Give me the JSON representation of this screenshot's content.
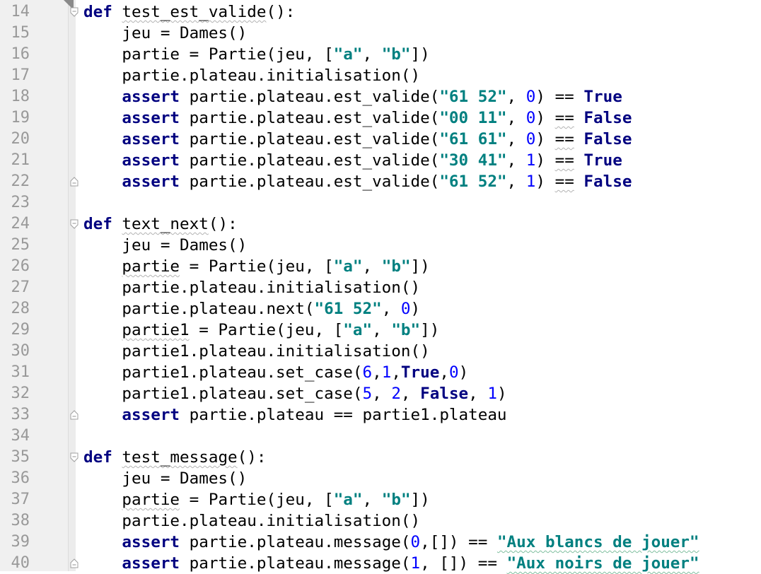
{
  "gutter": {
    "line_numbers": [
      "14",
      "15",
      "16",
      "17",
      "18",
      "19",
      "20",
      "21",
      "22",
      "23",
      "24",
      "25",
      "26",
      "27",
      "28",
      "29",
      "30",
      "31",
      "32",
      "33",
      "34",
      "35",
      "36",
      "37",
      "38",
      "39",
      "40"
    ]
  },
  "code": {
    "lines": [
      [
        {
          "t": "def",
          "s": "kw"
        },
        {
          "t": " ",
          "s": "plain"
        },
        {
          "t": "test_est_valide",
          "s": "squig"
        },
        {
          "t": "():",
          "s": "plain"
        }
      ],
      [
        {
          "t": "    jeu = Dames()",
          "s": "plain"
        }
      ],
      [
        {
          "t": "    partie = Partie(jeu, [",
          "s": "plain"
        },
        {
          "t": "\"a\"",
          "s": "str"
        },
        {
          "t": ", ",
          "s": "plain"
        },
        {
          "t": "\"b\"",
          "s": "str"
        },
        {
          "t": "])",
          "s": "plain"
        }
      ],
      [
        {
          "t": "    partie.plateau.initialisation()",
          "s": "plain"
        }
      ],
      [
        {
          "t": "    ",
          "s": "plain"
        },
        {
          "t": "assert",
          "s": "kw"
        },
        {
          "t": " partie.plateau.est_valide(",
          "s": "plain"
        },
        {
          "t": "\"61 52\"",
          "s": "str"
        },
        {
          "t": ", ",
          "s": "plain"
        },
        {
          "t": "0",
          "s": "num"
        },
        {
          "t": ") == ",
          "s": "plain"
        },
        {
          "t": "True",
          "s": "kw"
        }
      ],
      [
        {
          "t": "    ",
          "s": "plain"
        },
        {
          "t": "assert",
          "s": "kw"
        },
        {
          "t": " partie.plateau.est_valide(",
          "s": "plain"
        },
        {
          "t": "\"00 11\"",
          "s": "str"
        },
        {
          "t": ", ",
          "s": "plain"
        },
        {
          "t": "0",
          "s": "num"
        },
        {
          "t": ") ",
          "s": "plain"
        },
        {
          "t": "==",
          "s": "squig"
        },
        {
          "t": " ",
          "s": "plain"
        },
        {
          "t": "False",
          "s": "kw"
        }
      ],
      [
        {
          "t": "    ",
          "s": "plain"
        },
        {
          "t": "assert",
          "s": "kw"
        },
        {
          "t": " partie.plateau.est_valide(",
          "s": "plain"
        },
        {
          "t": "\"61 61\"",
          "s": "str"
        },
        {
          "t": ", ",
          "s": "plain"
        },
        {
          "t": "0",
          "s": "num"
        },
        {
          "t": ") ",
          "s": "plain"
        },
        {
          "t": "==",
          "s": "squig"
        },
        {
          "t": " ",
          "s": "plain"
        },
        {
          "t": "False",
          "s": "kw"
        }
      ],
      [
        {
          "t": "    ",
          "s": "plain"
        },
        {
          "t": "assert",
          "s": "kw"
        },
        {
          "t": " partie.plateau.est_valide(",
          "s": "plain"
        },
        {
          "t": "\"30 41\"",
          "s": "str"
        },
        {
          "t": ", ",
          "s": "plain"
        },
        {
          "t": "1",
          "s": "num"
        },
        {
          "t": ") ",
          "s": "plain"
        },
        {
          "t": "==",
          "s": "squig"
        },
        {
          "t": " ",
          "s": "plain"
        },
        {
          "t": "True",
          "s": "kw"
        }
      ],
      [
        {
          "t": "    ",
          "s": "plain"
        },
        {
          "t": "assert",
          "s": "kw"
        },
        {
          "t": " partie.plateau.est_valide(",
          "s": "plain"
        },
        {
          "t": "\"61 52\"",
          "s": "str"
        },
        {
          "t": ", ",
          "s": "plain"
        },
        {
          "t": "1",
          "s": "num"
        },
        {
          "t": ") ",
          "s": "plain"
        },
        {
          "t": "==",
          "s": "squig"
        },
        {
          "t": " ",
          "s": "plain"
        },
        {
          "t": "False",
          "s": "kw"
        }
      ],
      [],
      [
        {
          "t": "def",
          "s": "kw"
        },
        {
          "t": " ",
          "s": "plain"
        },
        {
          "t": "text_next",
          "s": "squig"
        },
        {
          "t": "():",
          "s": "plain"
        }
      ],
      [
        {
          "t": "    jeu = Dames()",
          "s": "plain"
        }
      ],
      [
        {
          "t": "    ",
          "s": "plain"
        },
        {
          "t": "partie",
          "s": "squig"
        },
        {
          "t": " = Partie(jeu, [",
          "s": "plain"
        },
        {
          "t": "\"a\"",
          "s": "str"
        },
        {
          "t": ", ",
          "s": "plain"
        },
        {
          "t": "\"b\"",
          "s": "str"
        },
        {
          "t": "])",
          "s": "plain"
        }
      ],
      [
        {
          "t": "    partie.plateau.initialisation()",
          "s": "plain"
        }
      ],
      [
        {
          "t": "    partie.plateau.next(",
          "s": "plain"
        },
        {
          "t": "\"61 52\"",
          "s": "str"
        },
        {
          "t": ", ",
          "s": "plain"
        },
        {
          "t": "0",
          "s": "num"
        },
        {
          "t": ")",
          "s": "plain"
        }
      ],
      [
        {
          "t": "    ",
          "s": "plain"
        },
        {
          "t": "partie1",
          "s": "squig"
        },
        {
          "t": " = Partie(jeu, [",
          "s": "plain"
        },
        {
          "t": "\"a\"",
          "s": "str"
        },
        {
          "t": ", ",
          "s": "plain"
        },
        {
          "t": "\"b\"",
          "s": "str"
        },
        {
          "t": "])",
          "s": "plain"
        }
      ],
      [
        {
          "t": "    partie1.plateau.initialisation()",
          "s": "plain"
        }
      ],
      [
        {
          "t": "    partie1.plateau.set_case(",
          "s": "plain"
        },
        {
          "t": "6",
          "s": "num"
        },
        {
          "t": ",",
          "s": "plain"
        },
        {
          "t": "1",
          "s": "num"
        },
        {
          "t": ",",
          "s": "plain"
        },
        {
          "t": "True",
          "s": "kw"
        },
        {
          "t": ",",
          "s": "plain"
        },
        {
          "t": "0",
          "s": "num"
        },
        {
          "t": ")",
          "s": "plain"
        }
      ],
      [
        {
          "t": "    partie1.plateau.set_case(",
          "s": "plain"
        },
        {
          "t": "5",
          "s": "num"
        },
        {
          "t": ", ",
          "s": "plain"
        },
        {
          "t": "2",
          "s": "num"
        },
        {
          "t": ", ",
          "s": "plain"
        },
        {
          "t": "False",
          "s": "kw"
        },
        {
          "t": ", ",
          "s": "plain"
        },
        {
          "t": "1",
          "s": "num"
        },
        {
          "t": ")",
          "s": "plain"
        }
      ],
      [
        {
          "t": "    ",
          "s": "plain"
        },
        {
          "t": "assert",
          "s": "kw"
        },
        {
          "t": " partie.plateau == partie1.plateau",
          "s": "plain"
        }
      ],
      [],
      [
        {
          "t": "def",
          "s": "kw"
        },
        {
          "t": " ",
          "s": "plain"
        },
        {
          "t": "test_message",
          "s": "squig"
        },
        {
          "t": "():",
          "s": "plain"
        }
      ],
      [
        {
          "t": "    jeu = Dames()",
          "s": "plain"
        }
      ],
      [
        {
          "t": "    ",
          "s": "plain"
        },
        {
          "t": "partie",
          "s": "squig"
        },
        {
          "t": " = Partie(jeu, [",
          "s": "plain"
        },
        {
          "t": "\"a\"",
          "s": "str"
        },
        {
          "t": ", ",
          "s": "plain"
        },
        {
          "t": "\"b\"",
          "s": "str"
        },
        {
          "t": "])",
          "s": "plain"
        }
      ],
      [
        {
          "t": "    partie.plateau.initialisation()",
          "s": "plain"
        }
      ],
      [
        {
          "t": "    ",
          "s": "plain"
        },
        {
          "t": "assert",
          "s": "kw"
        },
        {
          "t": " partie.plateau.message(",
          "s": "plain"
        },
        {
          "t": "0",
          "s": "num"
        },
        {
          "t": ",[]) == ",
          "s": "plain"
        },
        {
          "t": "\"Aux blancs de jouer\"",
          "s": "strsquig"
        }
      ],
      [
        {
          "t": "    ",
          "s": "plain"
        },
        {
          "t": "assert",
          "s": "kw"
        },
        {
          "t": " partie.plateau.message(",
          "s": "plain"
        },
        {
          "t": "1",
          "s": "num"
        },
        {
          "t": ", []) == ",
          "s": "plain"
        },
        {
          "t": "\"Aux noirs de jouer\"",
          "s": "strsquig"
        }
      ]
    ]
  },
  "folds": [
    {
      "line": 0,
      "kind": "open"
    },
    {
      "line": 8,
      "kind": "close"
    },
    {
      "line": 10,
      "kind": "open"
    },
    {
      "line": 19,
      "kind": "close"
    },
    {
      "line": 21,
      "kind": "open"
    },
    {
      "line": 26,
      "kind": "close"
    }
  ],
  "colors": {
    "keyword": "#000080",
    "string": "#008080",
    "number": "#0000ff",
    "gutter_bg": "#f0f0f0",
    "line_number": "#999999"
  }
}
